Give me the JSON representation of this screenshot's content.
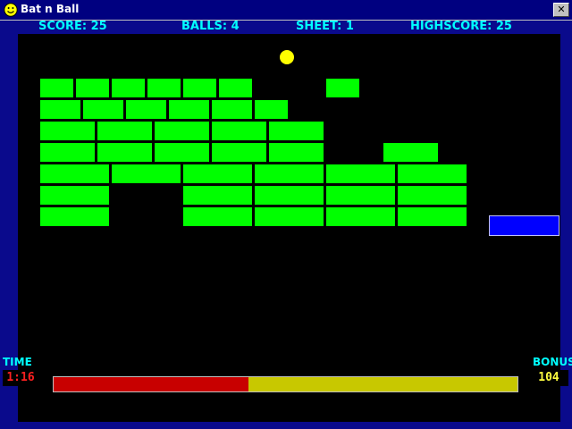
{
  "window": {
    "title": "Bat n Ball",
    "close_label": "✕"
  },
  "status": {
    "score_label": "SCORE: 25",
    "balls_label": "BALLS: 4",
    "sheet_label": "SHEET: 1",
    "highscore_label": "HIGHSCORE: 25"
  },
  "hud": {
    "time_label": "TIME",
    "time_value": "1:16",
    "bonus_label": "BONUS",
    "bonus_value": "104",
    "time_remaining_fraction": 0.42
  },
  "colors": {
    "brick": "#00ff00",
    "ball": "#ffff00",
    "bat": "#0000ff",
    "time_fill": "#c80000",
    "time_empty": "#c8c800",
    "time_value_color": "#ff2020",
    "bonus_value_color": "#ffff40"
  },
  "icons": {
    "app_icon": "smiley-icon"
  }
}
